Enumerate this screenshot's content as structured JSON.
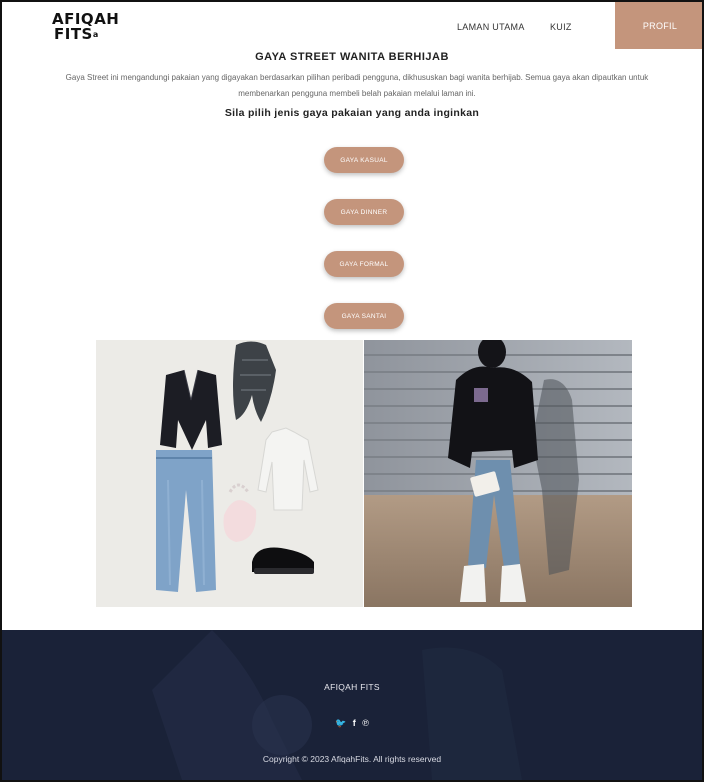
{
  "brand": {
    "line1": "AFIQAH",
    "line2": "FITS",
    "mark": "a"
  },
  "nav": {
    "home": "LAMAN UTAMA",
    "quiz": "KUIZ",
    "profile": "PROFIL"
  },
  "page": {
    "title": "GAYA STREET WANITA BERHIJAB",
    "intro": "Gaya Street ini mengandungi pakaian yang digayakan berdasarkan pilihan peribadi pengguna, dikhususkan bagi wanita berhijab. Semua gaya akan dipautkan untuk membenarkan pengguna membeli belah pakaian melalui laman ini.",
    "prompt": "Sila pilih jenis gaya pakaian yang anda inginkan"
  },
  "styles": [
    "GAYA KASUAL",
    "GAYA DINNER",
    "GAYA FORMAL",
    "GAYA SANTAI"
  ],
  "footer": {
    "brand": "AFIQAH FITS",
    "social": [
      "twitter-icon",
      "facebook-icon",
      "pinterest-icon"
    ],
    "social_glyphs": {
      "twitter": "🐦",
      "facebook": "f",
      "pinterest": "℗"
    },
    "copyright": "Copyright © 2023 AfiqahFits. All rights reserved"
  },
  "colors": {
    "accent": "#c4957c",
    "footer_bg": "#1a2238"
  }
}
